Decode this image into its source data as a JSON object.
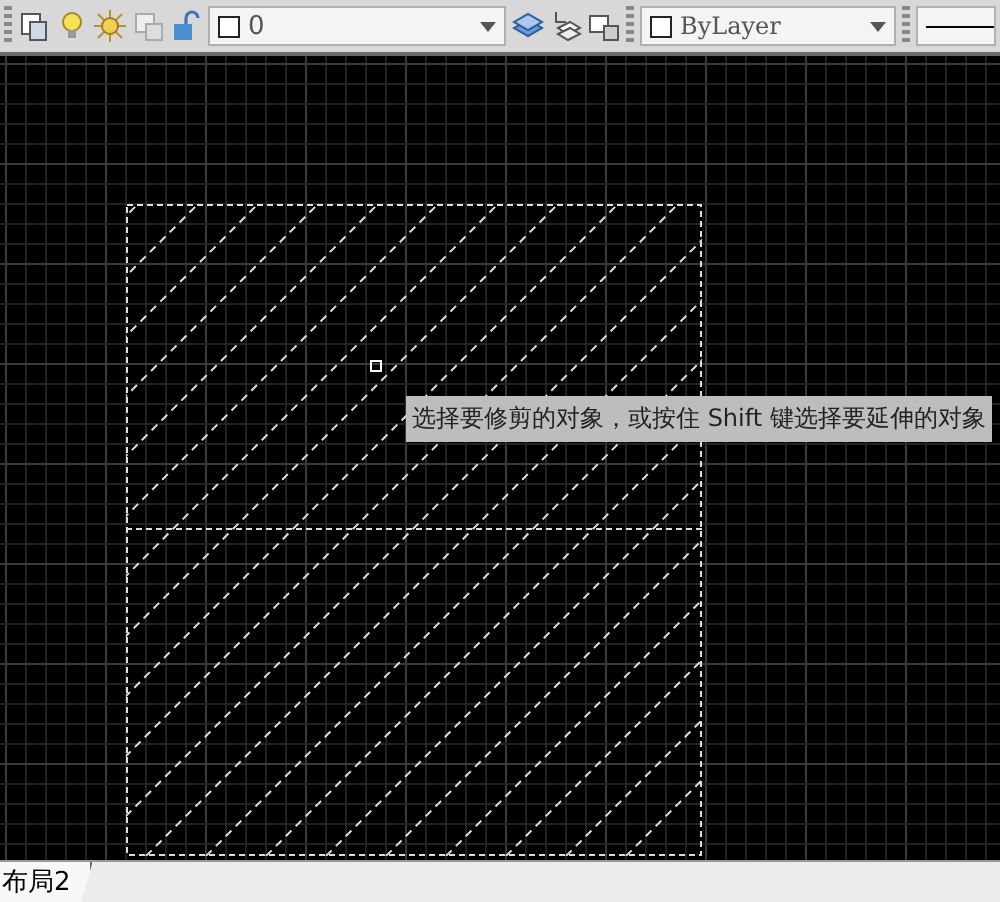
{
  "toolbar": {
    "layer_name": "0",
    "color_name": "ByLayer"
  },
  "tooltip": {
    "text": "选择要修剪的对象，或按住 Shift 键选择要延伸的对象"
  },
  "layout_tabs": [
    {
      "label": "布局2"
    }
  ]
}
